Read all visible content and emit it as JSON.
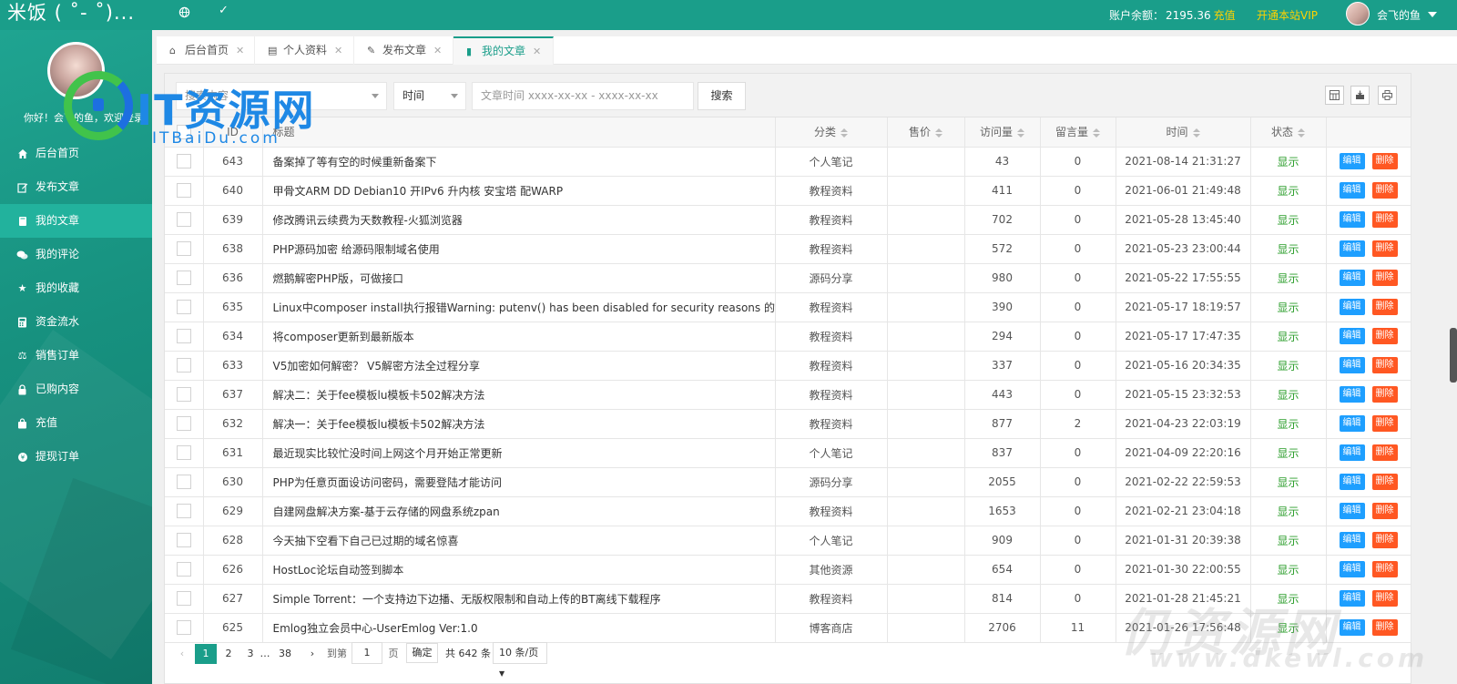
{
  "topbar": {
    "brand": "米饭 ( ˚- ˚)...",
    "balance_label": "账户余额：",
    "balance_value": "2195.36",
    "recharge_label": "充值",
    "vip_label": "开通本站VIP",
    "username": "会飞的鱼"
  },
  "sidebar": {
    "greeting": "你好！会飞的鱼，欢迎登录",
    "items": [
      {
        "label": "后台首页",
        "icon": "home-icon"
      },
      {
        "label": "发布文章",
        "icon": "edit-icon"
      },
      {
        "label": "我的文章",
        "icon": "book-icon"
      },
      {
        "label": "我的评论",
        "icon": "comments-icon"
      },
      {
        "label": "我的收藏",
        "icon": "star-icon"
      },
      {
        "label": "资金流水",
        "icon": "calculator-icon"
      },
      {
        "label": "销售订单",
        "icon": "balance-scale-icon"
      },
      {
        "label": "已购内容",
        "icon": "lock-icon"
      },
      {
        "label": "充值",
        "icon": "bag-icon"
      },
      {
        "label": "提现订单",
        "icon": "coins-icon"
      }
    ]
  },
  "tabs": [
    {
      "label": "后台首页",
      "icon": "home-icon"
    },
    {
      "label": "个人资料",
      "icon": "id-card-icon"
    },
    {
      "label": "发布文章",
      "icon": "edit-icon"
    },
    {
      "label": "我的文章",
      "icon": "book-icon"
    }
  ],
  "filters": {
    "keyword_placeholder": "搜索内容",
    "time_select": "时间",
    "date_placeholder": "文章时间 xxxx-xx-xx - xxxx-xx-xx",
    "search_button": "搜索"
  },
  "watermark": {
    "logo_text": "IT资源网",
    "logo_sub": "ITBaiDu.com",
    "corner_text": "仍资源网",
    "corner_sub": "www.dkewl.com"
  },
  "table": {
    "headers": {
      "id": "ID",
      "title": "标题",
      "category": "分类",
      "price": "售价",
      "views": "访问量",
      "comments": "留言量",
      "time": "时间",
      "status": "状态"
    },
    "edit_label": "编辑",
    "delete_label": "删除",
    "rows": [
      {
        "id": "643",
        "title": "备案掉了等有空的时候重新备案下",
        "category": "个人笔记",
        "price": "",
        "views": "43",
        "comments": "0",
        "time": "2021-08-14 21:31:27",
        "status": "显示"
      },
      {
        "id": "640",
        "title": "甲骨文ARM DD Debian10 开IPv6 升内核 安宝塔 配WARP",
        "category": "教程资料",
        "price": "",
        "views": "411",
        "comments": "0",
        "time": "2021-06-01 21:49:48",
        "status": "显示"
      },
      {
        "id": "639",
        "title": "修改腾讯云续费为天数教程-火狐浏览器",
        "category": "教程资料",
        "price": "",
        "views": "702",
        "comments": "0",
        "time": "2021-05-28 13:45:40",
        "status": "显示"
      },
      {
        "id": "638",
        "title": "PHP源码加密 给源码限制域名使用",
        "category": "教程资料",
        "price": "",
        "views": "572",
        "comments": "0",
        "time": "2021-05-23 23:00:44",
        "status": "显示"
      },
      {
        "id": "636",
        "title": "燃鹅解密PHP版，可做接口",
        "category": "源码分享",
        "price": "",
        "views": "980",
        "comments": "0",
        "time": "2021-05-22 17:55:55",
        "status": "显示"
      },
      {
        "id": "635",
        "title": "Linux中composer install执行报错Warning: putenv() has been disabled for security reasons 的解决问题",
        "category": "教程资料",
        "price": "",
        "views": "390",
        "comments": "0",
        "time": "2021-05-17 18:19:57",
        "status": "显示"
      },
      {
        "id": "634",
        "title": "将composer更新到最新版本",
        "category": "教程资料",
        "price": "",
        "views": "294",
        "comments": "0",
        "time": "2021-05-17 17:47:35",
        "status": "显示"
      },
      {
        "id": "633",
        "title": "V5加密如何解密？ V5解密方法全过程分享",
        "category": "教程资料",
        "price": "",
        "views": "337",
        "comments": "0",
        "time": "2021-05-16 20:34:35",
        "status": "显示"
      },
      {
        "id": "637",
        "title": "解决二：关于fee模板lu模板卡502解决方法",
        "category": "教程资料",
        "price": "",
        "views": "443",
        "comments": "0",
        "time": "2021-05-15 23:32:53",
        "status": "显示"
      },
      {
        "id": "632",
        "title": "解决一：关于fee模板lu模板卡502解决方法",
        "category": "教程资料",
        "price": "",
        "views": "877",
        "comments": "2",
        "time": "2021-04-23 22:03:19",
        "status": "显示"
      },
      {
        "id": "631",
        "title": "最近现实比较忙没时间上网这个月开始正常更新",
        "category": "个人笔记",
        "price": "",
        "views": "837",
        "comments": "0",
        "time": "2021-04-09 22:20:16",
        "status": "显示"
      },
      {
        "id": "630",
        "title": "PHP为任意页面设访问密码，需要登陆才能访问",
        "category": "源码分享",
        "price": "",
        "views": "2055",
        "comments": "0",
        "time": "2021-02-22 22:59:53",
        "status": "显示"
      },
      {
        "id": "629",
        "title": "自建网盘解决方案-基于云存储的网盘系统zpan",
        "category": "教程资料",
        "price": "",
        "views": "1653",
        "comments": "0",
        "time": "2021-02-21 23:04:18",
        "status": "显示"
      },
      {
        "id": "628",
        "title": "今天抽下空看下自己已过期的域名惊喜",
        "category": "个人笔记",
        "price": "",
        "views": "909",
        "comments": "0",
        "time": "2021-01-31 20:39:38",
        "status": "显示"
      },
      {
        "id": "626",
        "title": "HostLoc论坛自动签到脚本",
        "category": "其他资源",
        "price": "",
        "views": "654",
        "comments": "0",
        "time": "2021-01-30 22:00:55",
        "status": "显示"
      },
      {
        "id": "627",
        "title": "Simple Torrent：一个支持边下边播、无版权限制和自动上传的BT离线下载程序",
        "category": "教程资料",
        "price": "",
        "views": "814",
        "comments": "0",
        "time": "2021-01-28 21:45:21",
        "status": "显示"
      },
      {
        "id": "625",
        "title": "Emlog独立会员中心-UserEmlog Ver:1.0",
        "category": "博客商店",
        "price": "",
        "views": "2706",
        "comments": "11",
        "time": "2021-01-26 17:56:48",
        "status": "显示"
      }
    ]
  },
  "pagination": {
    "pages": [
      "1",
      "2",
      "3",
      "…",
      "38"
    ],
    "current": "1",
    "goto_label": "到第",
    "goto_value": "1",
    "page_unit": "页",
    "confirm": "确定",
    "total": "共 642 条",
    "per_page": "10 条/页"
  },
  "colors": {
    "primary": "#1a9e8a",
    "edit": "#1e9fff",
    "delete": "#ff5722",
    "gold": "#ffd200"
  }
}
